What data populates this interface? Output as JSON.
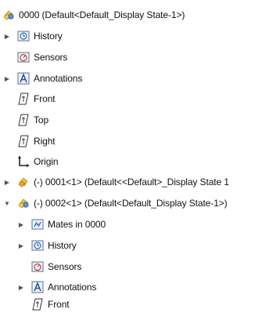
{
  "tree": {
    "root": {
      "label": "0000  (Default<Default_Display State-1>)",
      "icon": "assembly-icon"
    },
    "items": [
      {
        "label": "History",
        "icon": "history-folder-icon",
        "expandable": true
      },
      {
        "label": "Sensors",
        "icon": "sensors-folder-icon",
        "expandable": false
      },
      {
        "label": "Annotations",
        "icon": "annotations-folder-icon",
        "expandable": true
      },
      {
        "label": "Front",
        "icon": "plane-icon",
        "expandable": false
      },
      {
        "label": "Top",
        "icon": "plane-icon",
        "expandable": false
      },
      {
        "label": "Right",
        "icon": "plane-icon",
        "expandable": false
      },
      {
        "label": "Origin",
        "icon": "origin-icon",
        "expandable": false
      },
      {
        "label": "(-) 0001<1> (Default<<Default>_Display State 1",
        "icon": "subassembly-icon",
        "expandable": true,
        "expanded": false
      },
      {
        "label": "(-) 0002<1> (Default<Default_Display State-1>)",
        "icon": "subassembly-icon",
        "expandable": true,
        "expanded": true
      }
    ],
    "children": [
      {
        "label": "Mates in 0000",
        "icon": "mates-folder-icon",
        "expandable": true
      },
      {
        "label": "History",
        "icon": "history-folder-icon",
        "expandable": true
      },
      {
        "label": "Sensors",
        "icon": "sensors-folder-icon",
        "expandable": false
      },
      {
        "label": "Annotations",
        "icon": "annotations-folder-icon",
        "expandable": true
      },
      {
        "label": "Front",
        "icon": "plane-icon",
        "expandable": false
      }
    ]
  }
}
